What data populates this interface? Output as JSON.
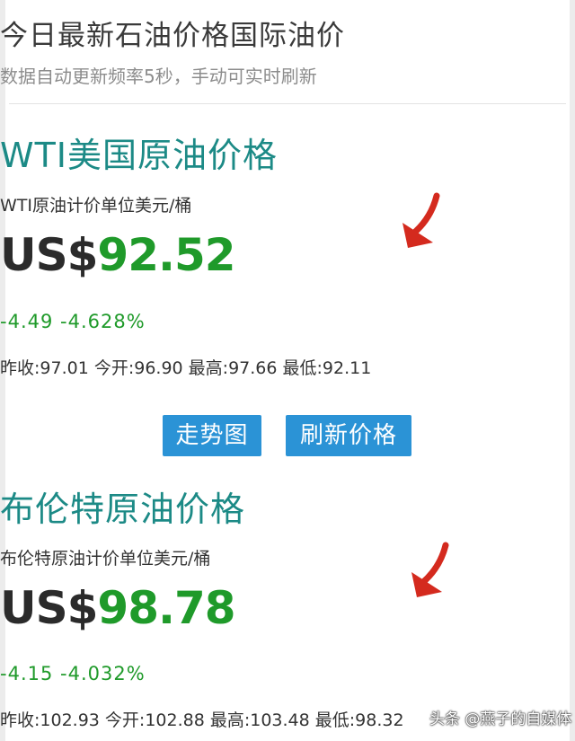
{
  "header": {
    "title": "今日最新石油价格国际油价",
    "subtitle": "数据自动更新频率5秒，手动可实时刷新"
  },
  "wti": {
    "title": "WTI美国原油价格",
    "unit": "WTI原油计价单位美元/桶",
    "currency": "US$",
    "price": "92.52",
    "change": "-4.49 -4.628%",
    "stats": "昨收:97.01 今开:96.90 最高:97.66 最低:92.11"
  },
  "buttons": {
    "trend": "走势图",
    "refresh": "刷新价格"
  },
  "brent": {
    "title": "布伦特原油价格",
    "unit": "布伦特原油计价单位美元/桶",
    "currency": "US$",
    "price": "98.78",
    "change": "-4.15 -4.032%",
    "stats": "昨收:102.93 今开:102.88 最高:103.48 最低:98.32"
  },
  "watermark": "头条 @燕子的自媒体",
  "colors": {
    "title_teal": "#1c8a86",
    "price_green": "#1f9a2a",
    "button_blue": "#2b93d6",
    "annotation_red": "#d42a1e"
  },
  "icons": {
    "annotation": "red-arrow-icon"
  }
}
